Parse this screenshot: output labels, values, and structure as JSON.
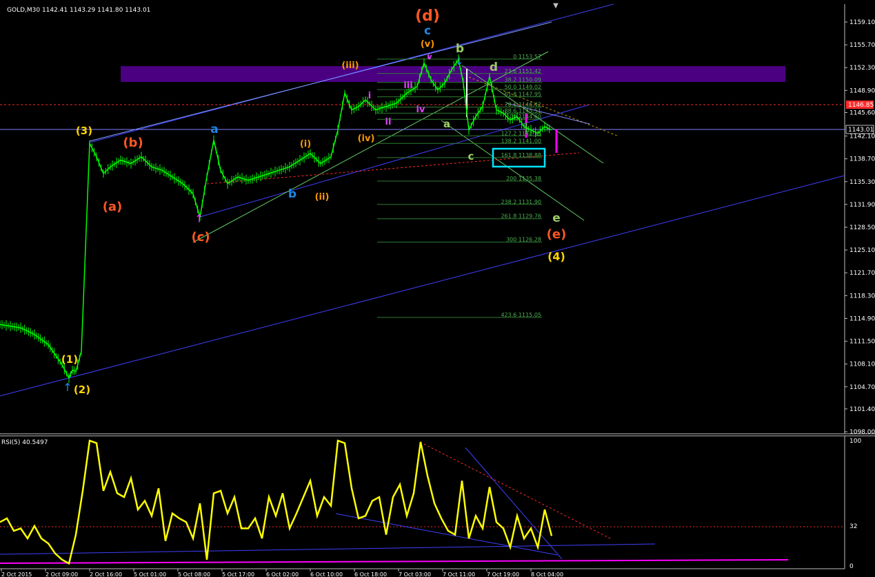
{
  "window": {
    "info": "GOLD,M30  1142.41 1143.29 1141.80 1143.01"
  },
  "colors": {
    "background": "#000000",
    "grid_frame": "#c0c0c0",
    "candle": "#00ff00",
    "channel": "#4040ff",
    "resistance_zone": "#4b0082",
    "fib": "#2e7d32",
    "rsi": "#ffff00",
    "rsi_floor": "#ff00ff",
    "target_box": "#00e5ff",
    "price_line_red": "#ff2a2a"
  },
  "chart_data": [
    {
      "type": "line",
      "title": "GOLD,M30",
      "symbol": "GOLD",
      "timeframe": "M30",
      "ohlc": {
        "open": 1142.41,
        "high": 1143.29,
        "low": 1141.8,
        "close": 1143.01
      },
      "ylim": [
        1098.0,
        1160.5
      ],
      "ytick_labels": [
        "1159.10",
        "1155.70",
        "1152.30",
        "1148.90",
        "1145.60",
        "1142.10",
        "1138.70",
        "1135.30",
        "1131.90",
        "1128.50",
        "1125.10",
        "1121.70",
        "1118.30",
        "1114.90",
        "1111.50",
        "1108.10",
        "1104.70",
        "1101.40",
        "1098.00"
      ],
      "xtick_labels": [
        "2 Oct 2015",
        "2 Oct 09:00",
        "2 Oct 16:00",
        "5 Oct 01:00",
        "5 Oct 08:00",
        "5 Oct 17:00",
        "6 Oct 02:00",
        "6 Oct 10:00",
        "6 Oct 18:00",
        "7 Oct 03:00",
        "7 Oct 11:00",
        "7 Oct 19:00",
        "8 Oct 04:00"
      ],
      "price_labels": {
        "current": "1143.01",
        "red_level": "1146.85"
      },
      "x": [
        0,
        30,
        50,
        70,
        90,
        100,
        105,
        110,
        118,
        125,
        130,
        140,
        150,
        160,
        175,
        190,
        205,
        220,
        235,
        250,
        265,
        280,
        290,
        300,
        310,
        320,
        330,
        345,
        360,
        375,
        390,
        405,
        420,
        435,
        450,
        465,
        480,
        490,
        500,
        510,
        520,
        530,
        545,
        560,
        575,
        590,
        605,
        615,
        625,
        635,
        645,
        655,
        665,
        672,
        680,
        690,
        700,
        710,
        720,
        730,
        740,
        750,
        760,
        770,
        780,
        790,
        800
      ],
      "close": [
        1114.0,
        1113.5,
        1112.5,
        1111.0,
        1108.0,
        1106.0,
        1107.2,
        1107.0,
        1110.0,
        1128.0,
        1141.0,
        1139.0,
        1136.5,
        1137.5,
        1138.5,
        1138.0,
        1139.0,
        1137.5,
        1137.0,
        1136.0,
        1135.0,
        1133.5,
        1130.0,
        1136.0,
        1141.5,
        1137.0,
        1135.0,
        1136.0,
        1135.5,
        1136.0,
        1136.5,
        1137.0,
        1137.5,
        1138.5,
        1139.5,
        1138.0,
        1139.0,
        1143.0,
        1148.5,
        1146.0,
        1146.5,
        1147.5,
        1146.0,
        1146.5,
        1147.0,
        1148.5,
        1149.5,
        1153.0,
        1150.5,
        1149.0,
        1150.0,
        1152.0,
        1153.5,
        1150.0,
        1143.0,
        1145.0,
        1146.5,
        1151.0,
        1146.0,
        1145.5,
        1144.5,
        1145.0,
        1143.5,
        1143.0,
        1142.5,
        1143.5,
        1143.01
      ]
    },
    {
      "type": "line",
      "title": "RSI(5) 40.5497",
      "ylim": [
        0,
        100
      ],
      "ytick_labels": [
        "100",
        "32",
        "0"
      ],
      "x": [
        0,
        10,
        20,
        30,
        40,
        50,
        60,
        70,
        80,
        90,
        100,
        110,
        120,
        130,
        140,
        150,
        160,
        170,
        180,
        190,
        200,
        210,
        220,
        230,
        240,
        250,
        260,
        270,
        280,
        290,
        300,
        310,
        320,
        330,
        340,
        350,
        360,
        370,
        380,
        390,
        400,
        410,
        420,
        430,
        440,
        450,
        460,
        470,
        480,
        490,
        500,
        510,
        520,
        530,
        540,
        550,
        560,
        570,
        580,
        590,
        600,
        610,
        620,
        630,
        640,
        650,
        660,
        670,
        680,
        690,
        700,
        710,
        720,
        730,
        740,
        750,
        760,
        770,
        780,
        790,
        800
      ],
      "values": [
        35,
        38,
        28,
        30,
        22,
        32,
        22,
        18,
        10,
        5,
        2,
        25,
        60,
        100,
        98,
        60,
        75,
        58,
        55,
        70,
        45,
        52,
        40,
        62,
        20,
        42,
        38,
        35,
        22,
        50,
        5,
        58,
        60,
        42,
        55,
        30,
        30,
        38,
        22,
        55,
        40,
        58,
        30,
        42,
        55,
        68,
        40,
        55,
        48,
        100,
        98,
        62,
        38,
        40,
        52,
        55,
        25,
        55,
        65,
        40,
        58,
        99,
        72,
        50,
        38,
        28,
        25,
        68,
        22,
        40,
        30,
        63,
        35,
        30,
        15,
        40,
        22,
        30,
        15,
        45,
        24
      ]
    }
  ],
  "wave_labels": [
    {
      "text": "(d)",
      "color": "#ff5722"
    },
    {
      "text": "c",
      "color": "#1e88e5"
    },
    {
      "text": "(v)",
      "color": "#ff9800"
    },
    {
      "text": "v",
      "color": "#e040fb"
    },
    {
      "text": "b",
      "color": "#9ccc65"
    },
    {
      "text": "d",
      "color": "#9ccc65"
    },
    {
      "text": "(iii)",
      "color": "#ff9800"
    },
    {
      "text": "i",
      "color": "#e040fb"
    },
    {
      "text": "iii",
      "color": "#e040fb"
    },
    {
      "text": "ii",
      "color": "#e040fb"
    },
    {
      "text": "iv",
      "color": "#e040fb"
    },
    {
      "text": "a",
      "color": "#9ccc65"
    },
    {
      "text": "(iv)",
      "color": "#ff9800"
    },
    {
      "text": "c",
      "color": "#9ccc65"
    },
    {
      "text": "(3)",
      "color": "#ffd600"
    },
    {
      "text": "(b)",
      "color": "#ff5722"
    },
    {
      "text": "a",
      "color": "#1e88e5"
    },
    {
      "text": "(i)",
      "color": "#ff9800"
    },
    {
      "text": "b",
      "color": "#1e88e5"
    },
    {
      "text": "(ii)",
      "color": "#ff9800"
    },
    {
      "text": "(a)",
      "color": "#ff5722"
    },
    {
      "text": "(c)",
      "color": "#ff5722"
    },
    {
      "text": "e",
      "color": "#9ccc65"
    },
    {
      "text": "(e)",
      "color": "#ff5722"
    },
    {
      "text": "(4)",
      "color": "#ffd600"
    },
    {
      "text": "(1)",
      "color": "#ffd600"
    },
    {
      "text": "(2)",
      "color": "#ffd600"
    }
  ],
  "fib_labels": [
    "0 1153.57",
    "23.6 1151.42",
    "38.2 1150.09",
    "50.0 1149.02",
    "61.8 1147.95",
    "78.6 1146.42",
    "88.6 1145.51",
    "100 1144.60",
    "127.2 1142.13",
    "138.2 1141.00",
    "161.8 1138.88",
    "200 1135.38",
    "238.2 1131.90",
    "261.8 1129.76",
    "300 1126.28",
    "423.6 1115.05"
  ]
}
